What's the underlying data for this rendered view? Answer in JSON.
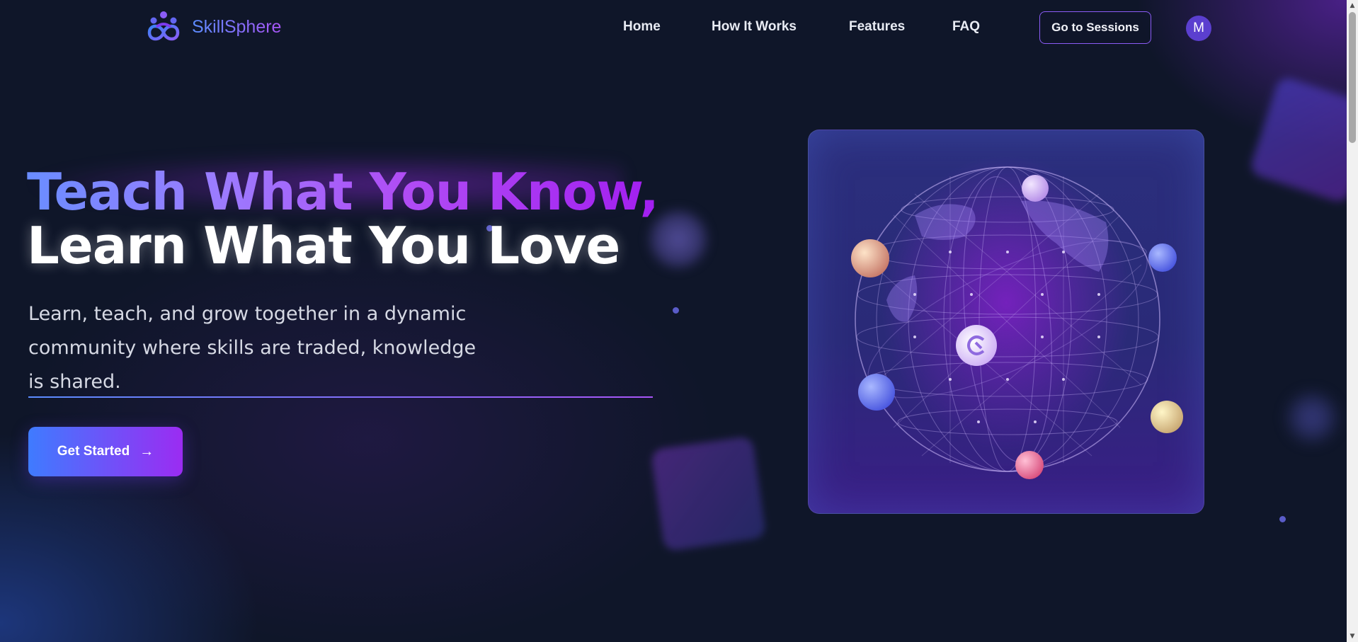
{
  "brand": {
    "name": "SkillSphere",
    "logo_icon": "people-infinity-logo-icon"
  },
  "nav": {
    "links": [
      {
        "label": "Home"
      },
      {
        "label": "How It Works"
      },
      {
        "label": "Features"
      },
      {
        "label": "FAQ"
      }
    ],
    "sessions_button": "Go to Sessions",
    "avatar_initial": "M"
  },
  "hero": {
    "title_line_1": "Teach What You Know,",
    "title_line_2": "Learn What You Love",
    "subtitle": "Learn, teach, and grow together in a dynamic community where skills are traded, knowledge is shared.",
    "cta_label": "Get Started",
    "cta_icon": "arrow-right-icon"
  },
  "colors": {
    "background": "#0f1629",
    "accent_blue": "#5b8cff",
    "accent_purple": "#a855f7"
  }
}
